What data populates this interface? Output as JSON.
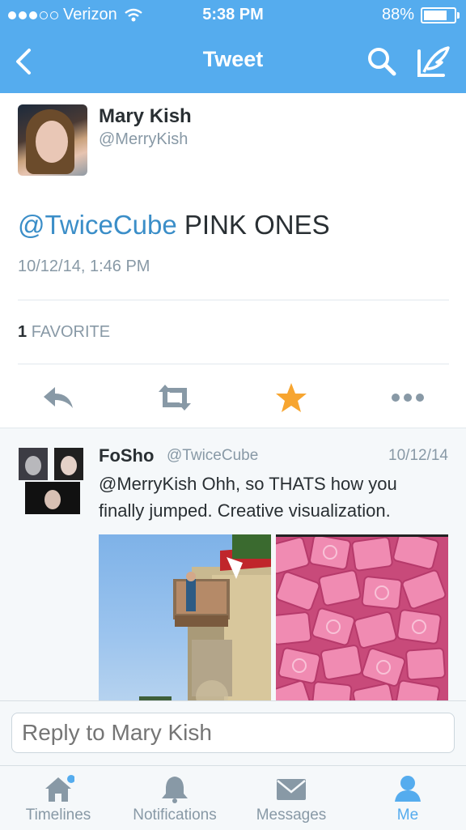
{
  "status_bar": {
    "carrier": "Verizon",
    "time": "5:38 PM",
    "battery": "88%",
    "battery_level": 0.88
  },
  "nav": {
    "title": "Tweet",
    "back_icon": "chevron-left-icon",
    "search_icon": "search-icon",
    "compose_icon": "compose-icon"
  },
  "tweet": {
    "name": "Mary Kish",
    "handle": "@MerryKish",
    "mention": "@TwiceCube",
    "text": " PINK ONES",
    "timestamp": "10/12/14, 1:46 PM",
    "favorites_count": "1",
    "favorites_label": "FAVORITE"
  },
  "actions": [
    {
      "name": "reply",
      "icon": "reply-icon"
    },
    {
      "name": "retweet",
      "icon": "retweet-icon"
    },
    {
      "name": "favorite",
      "icon": "star-icon",
      "active_color": "#f7a530"
    },
    {
      "name": "more",
      "icon": "more-icon"
    }
  ],
  "reply": {
    "name": "FoSho",
    "handle": "@TwiceCube",
    "date": "10/12/14",
    "text": "@MerryKish Ohh, so THATS how you finally jumped. Creative visualization."
  },
  "reply_input": {
    "placeholder": "Reply to Mary Kish"
  },
  "tabs": [
    {
      "label": "Timelines",
      "icon": "home-icon"
    },
    {
      "label": "Notifications",
      "icon": "bell-icon"
    },
    {
      "label": "Messages",
      "icon": "envelope-icon"
    },
    {
      "label": "Me",
      "icon": "person-icon",
      "active": true
    }
  ],
  "colors": {
    "brand": "#55acee",
    "link": "#3b8ec8",
    "muted": "#8899a6",
    "text": "#292f33",
    "star": "#f7a530"
  }
}
